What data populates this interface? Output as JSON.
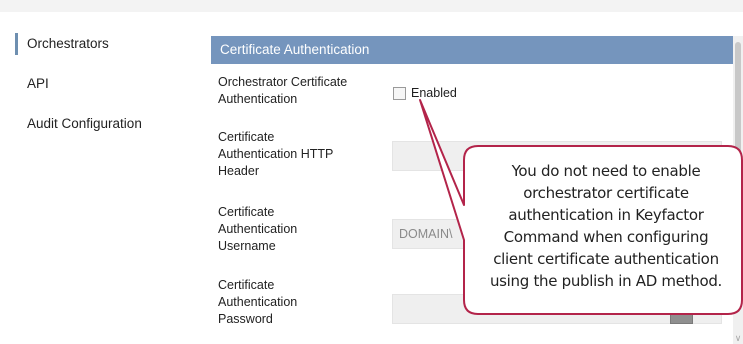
{
  "nav": {
    "items": [
      {
        "label": "Orchestrators",
        "active": true
      },
      {
        "label": "API",
        "active": false
      },
      {
        "label": "Audit Configuration",
        "active": false
      }
    ]
  },
  "panel": {
    "title": "Certificate Authentication",
    "fields": {
      "orch_cert_auth": {
        "label_line1": "Orchestrator Certificate",
        "label_line2": "Authentication",
        "checkbox_label": "Enabled",
        "checked": false
      },
      "http_header": {
        "label_line1": "Certificate",
        "label_line2": "Authentication HTTP",
        "label_line3": "Header",
        "value": ""
      },
      "username": {
        "label_line1": "Certificate",
        "label_line2": "Authentication",
        "label_line3": "Username",
        "value": "DOMAIN\\"
      },
      "password": {
        "label_line1": "Certificate",
        "label_line2": "Authentication",
        "label_line3": "Password",
        "value": ""
      }
    }
  },
  "callout": {
    "lines": [
      "You do not need to enable",
      "orchestrator certificate",
      "authentication in Keyfactor",
      "Command when configuring",
      "client certificate authentication",
      "using the publish in AD method."
    ],
    "border_color": "#b3244a"
  }
}
